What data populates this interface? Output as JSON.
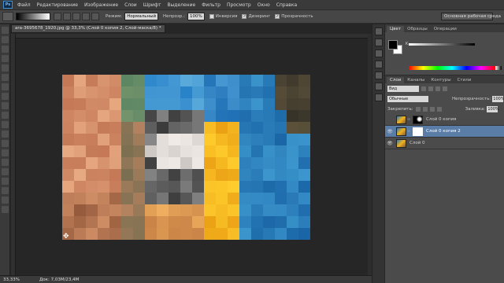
{
  "menubar": {
    "items": [
      "Файл",
      "Редактирование",
      "Изображение",
      "Слои",
      "Шрифт",
      "Выделение",
      "Фильтр",
      "Просмотр",
      "Окно",
      "Справка"
    ]
  },
  "options": {
    "mode_label": "Режим:",
    "mode_value": "Нормальный",
    "opacity_label": "Непрозр.:",
    "opacity_value": "100%",
    "inverse": "Инверсия",
    "dither": "Дизеринг",
    "transparency": "Прозрачность",
    "workspace": "Основная рабочая среда"
  },
  "document": {
    "tab_title": "ara-3695678_1920.jpg @ 33,3% (Слой 0 копия 2, Слой-маска/8) *"
  },
  "status": {
    "zoom": "33,33%",
    "doc_size": "Док: 7,03M/23,4M"
  },
  "color_panel": {
    "tabs": [
      "Цвет",
      "Образцы",
      "Операции"
    ],
    "k_label": "K"
  },
  "layers_panel": {
    "tabs": [
      "Слои",
      "Каналы",
      "Контуры",
      "Стили"
    ],
    "kind": "Вид",
    "blend_mode": "Обычные",
    "opacity_label": "Непрозрачность:",
    "opacity_value": "100%",
    "lock_label": "Закрепить:",
    "fill_label": "Заливка:",
    "fill_value": "100%",
    "layers": [
      {
        "name": "Слой 0 копия",
        "visible": false,
        "mask": "dark",
        "selected": false
      },
      {
        "name": "Слой 0 копия 2",
        "visible": true,
        "mask": "white",
        "selected": true
      },
      {
        "name": "Слой 0",
        "visible": true,
        "mask": null,
        "selected": false
      }
    ]
  },
  "colors": {
    "accent_selected": "#5a7da8",
    "parrot_blue": "#2f74b5",
    "parrot_yellow": "#f2b21b"
  }
}
